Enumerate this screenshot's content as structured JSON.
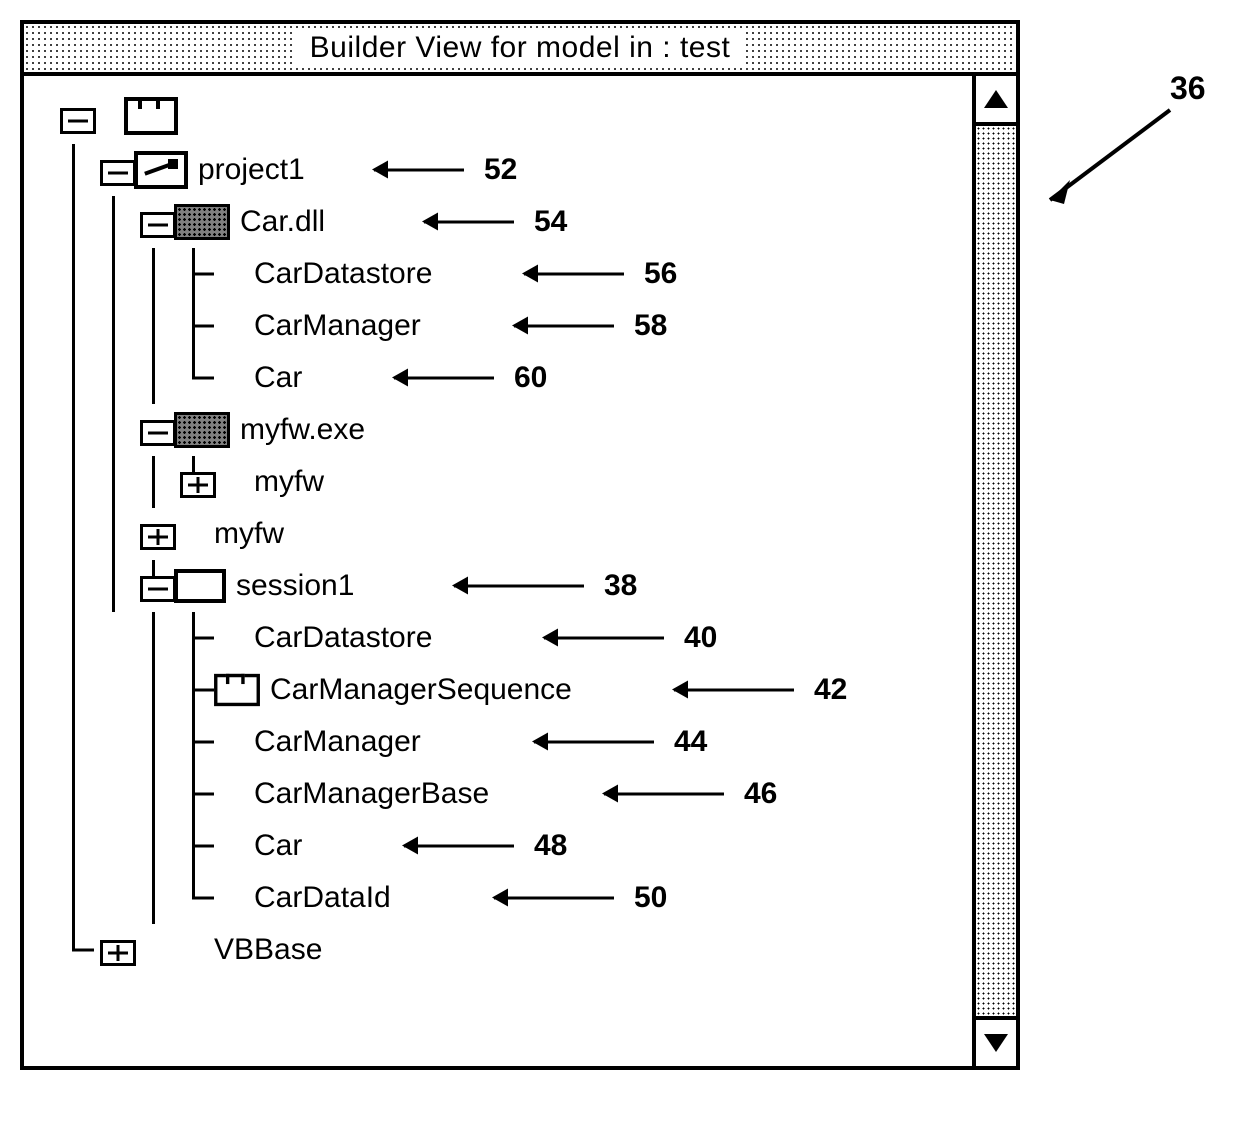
{
  "window": {
    "title": "Builder View for model in : test"
  },
  "tree": {
    "root": {
      "project": {
        "label": "project1",
        "ref": "52"
      },
      "car_dll": {
        "label": "Car.dll",
        "ref": "54"
      },
      "car_dll_children": {
        "datastore": {
          "label": "CarDatastore",
          "ref": "56"
        },
        "manager": {
          "label": "CarManager",
          "ref": "58"
        },
        "car": {
          "label": "Car",
          "ref": "60"
        }
      },
      "myfw_exe": {
        "label": "myfw.exe"
      },
      "myfw_inner": {
        "label": "myfw"
      },
      "myfw2": {
        "label": "myfw"
      },
      "session": {
        "label": "session1",
        "ref": "38"
      },
      "session_children": {
        "datastore": {
          "label": "CarDatastore",
          "ref": "40"
        },
        "seq": {
          "label": "CarManagerSequence",
          "ref": "42"
        },
        "manager": {
          "label": "CarManager",
          "ref": "44"
        },
        "base": {
          "label": "CarManagerBase",
          "ref": "46"
        },
        "car": {
          "label": "Car",
          "ref": "48"
        },
        "dataid": {
          "label": "CarDataId",
          "ref": "50"
        }
      },
      "vbbase": {
        "label": "VBBase"
      }
    }
  },
  "figure_ref": "36"
}
